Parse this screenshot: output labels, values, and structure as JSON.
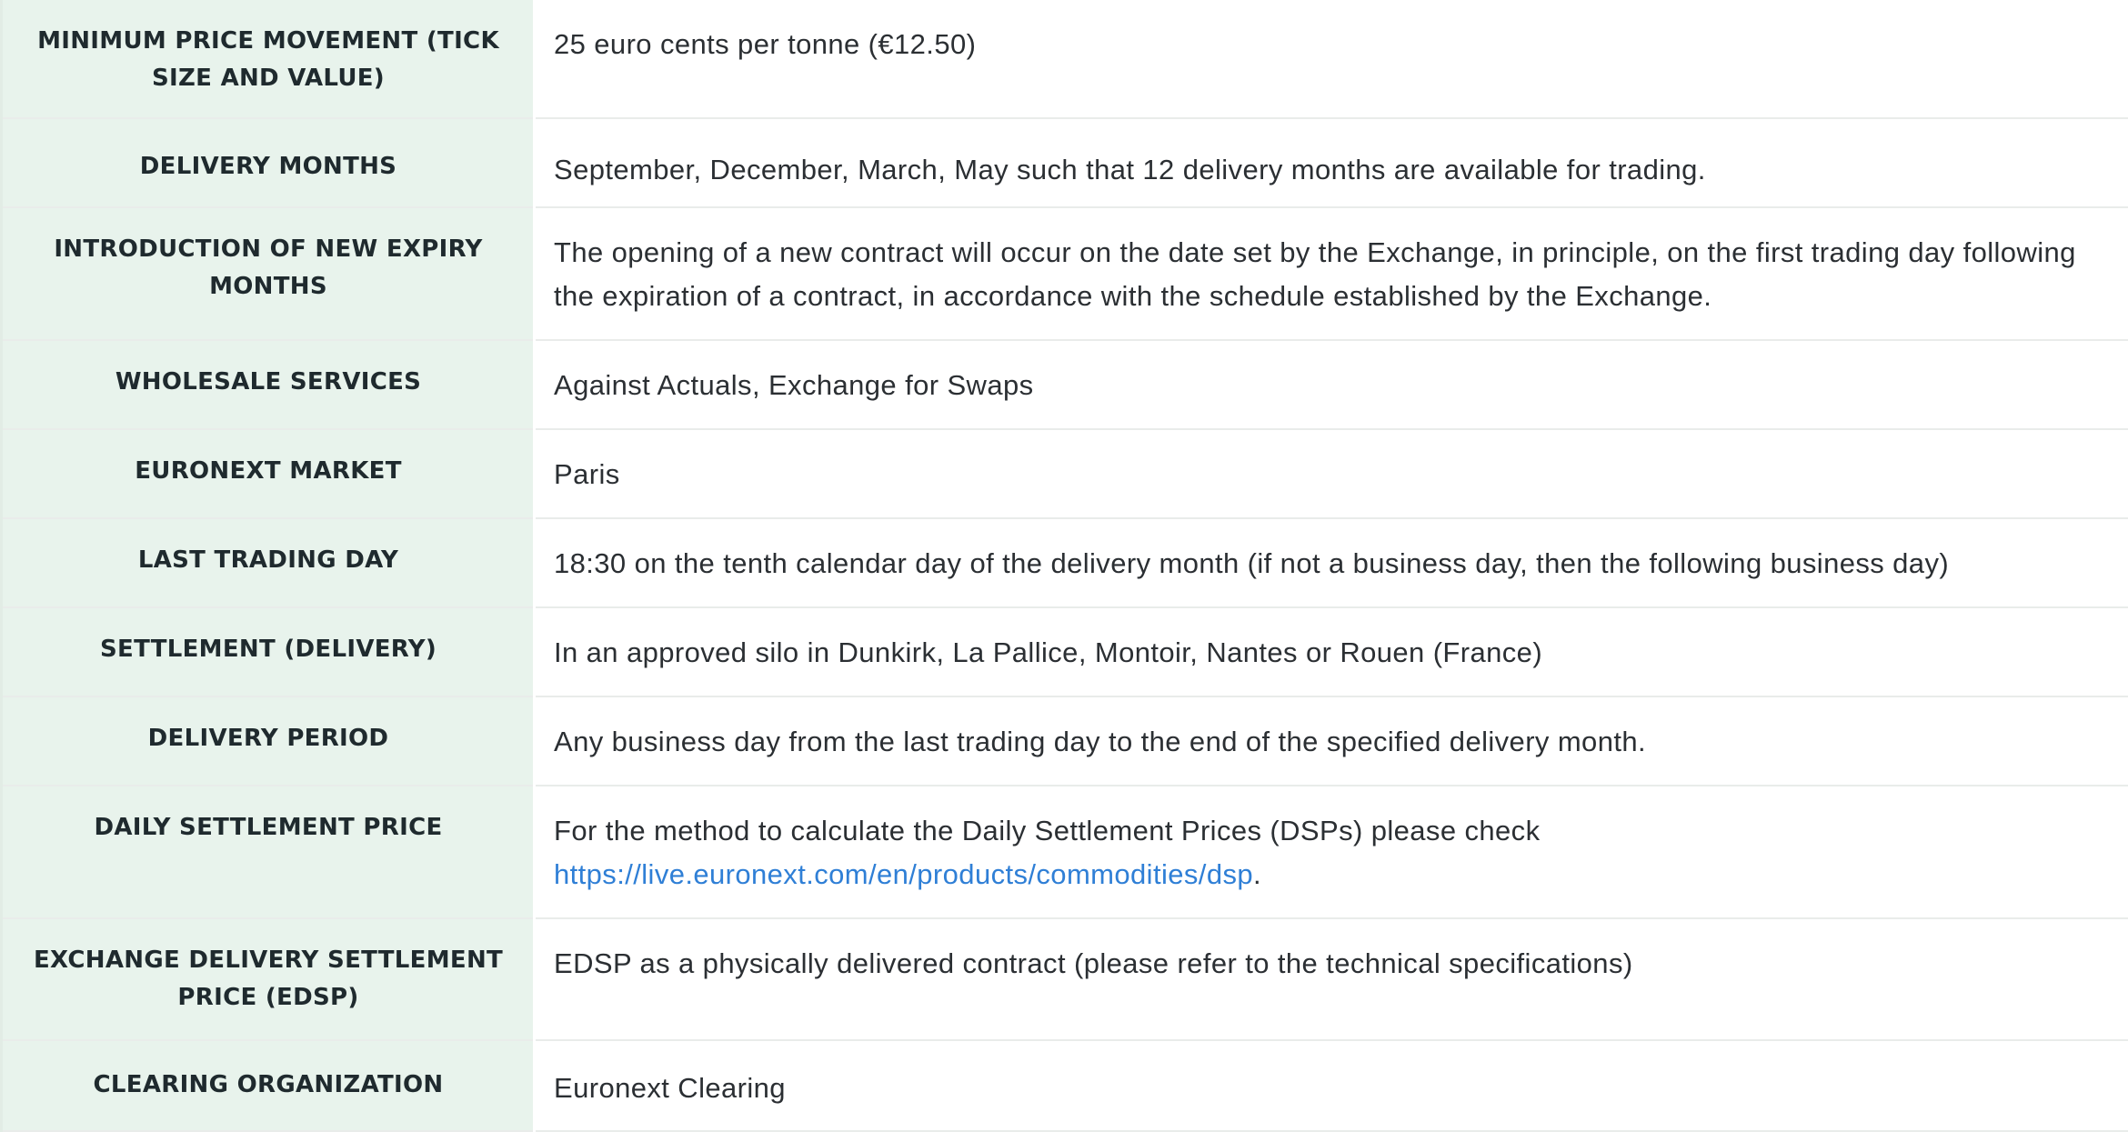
{
  "rows": [
    {
      "label": "MINIMUM PRICE MOVEMENT (TICK SIZE AND VALUE)",
      "value": "25 euro cents per tonne (€12.50)"
    },
    {
      "label": "DELIVERY MONTHS",
      "value": "September, December, March, May such that 12 delivery months are available for trading."
    },
    {
      "label": "INTRODUCTION OF NEW EXPIRY MONTHS",
      "value": "The opening of a new contract will occur on the date set by the Exchange, in principle, on the first trading day following the expiration of a contract, in accordance with the schedule established by the Exchange."
    },
    {
      "label": "WHOLESALE SERVICES",
      "value": "Against Actuals, Exchange for Swaps"
    },
    {
      "label": "EURONEXT MARKET",
      "value": "Paris"
    },
    {
      "label": "LAST TRADING DAY",
      "value": "18:30 on the tenth calendar day of the delivery month (if not a business day, then the following business day)"
    },
    {
      "label": "SETTLEMENT (DELIVERY)",
      "value": "In an approved silo in Dunkirk, La Pallice, Montoir, Nantes or Rouen  (France)"
    },
    {
      "label": "DELIVERY PERIOD",
      "value": "Any business day from the last trading day to the end of the specified delivery month."
    },
    {
      "label": "DAILY SETTLEMENT PRICE",
      "value_prefix": "For the method to calculate the Daily Settlement Prices (DSPs) please check",
      "link": "https://live.euronext.com/en/products/commodities/dsp",
      "value_suffix": "."
    },
    {
      "label": "EXCHANGE DELIVERY SETTLEMENT PRICE (EDSP)",
      "value": "EDSP as a physically delivered contract (please refer to the technical specifications)"
    },
    {
      "label": "CLEARING ORGANIZATION",
      "value": "Euronext Clearing"
    }
  ],
  "colors": {
    "label_background": "#e8f3ec",
    "link": "#2f7fd6",
    "text": "#2b2f33"
  }
}
